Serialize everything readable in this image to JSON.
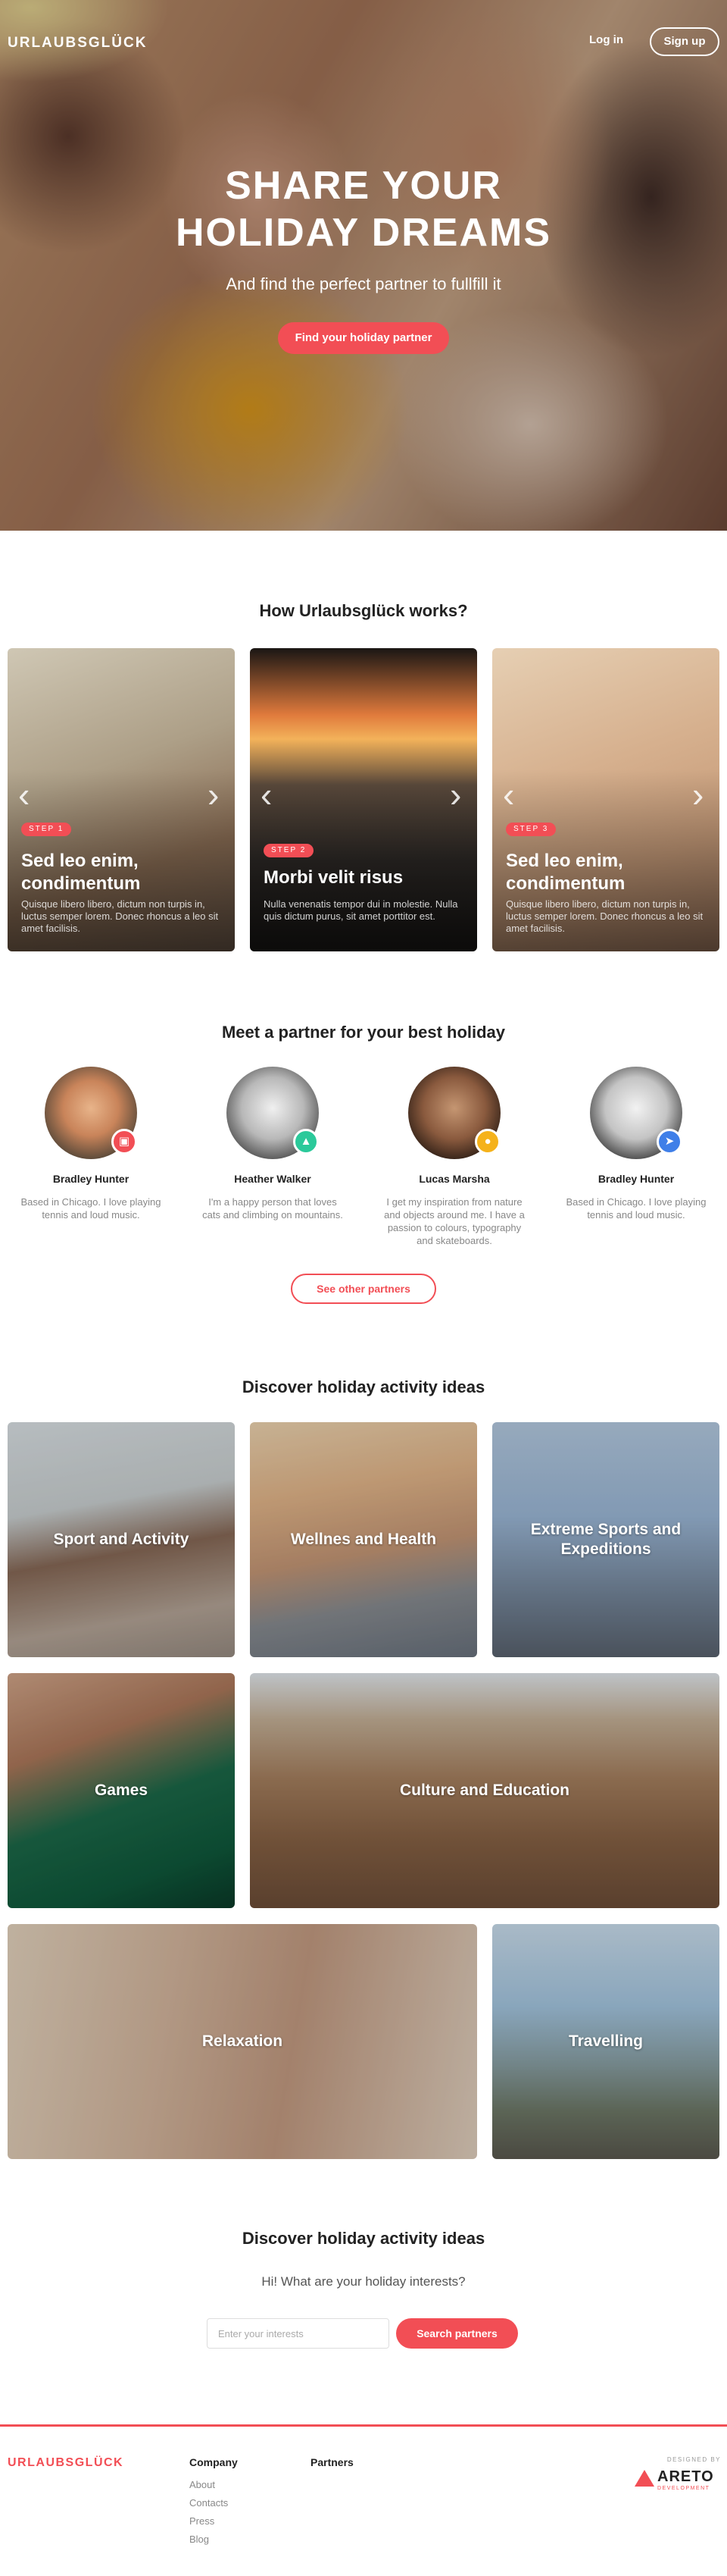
{
  "header": {
    "logo": "URLAUBSGLÜCK",
    "login_label": "Log in",
    "signup_label": "Sign up"
  },
  "hero": {
    "title_line1": "SHARE YOUR",
    "title_line2": "HOLIDAY DREAMS",
    "subtitle": "And find the perfect partner to fullfill it",
    "cta_label": "Find your holiday partner"
  },
  "how": {
    "title": "How Urlaubsglück works?",
    "cards": [
      {
        "step": "STEP 1",
        "title": "Sed leo enim, condimentum",
        "text": "Quisque libero libero, dictum non turpis in, luctus semper lorem. Donec rhoncus a leo sit amet facilisis."
      },
      {
        "step": "STEP 2",
        "title": "Morbi velit risus",
        "text": "Nulla venenatis tempor dui in molestie. Nulla quis dictum purus, sit amet porttitor est."
      },
      {
        "step": "STEP 3",
        "title": "Sed leo enim, condimentum",
        "text": "Quisque libero libero, dictum non turpis in, luctus semper lorem. Donec rhoncus a leo sit amet facilisis."
      }
    ],
    "prev_icon": "chevron-left-icon",
    "next_icon": "chevron-right-icon"
  },
  "partners": {
    "title": "Meet a partner for your best holiday",
    "items": [
      {
        "name": "Bradley Hunter",
        "bio": "Based in Chicago. I love playing tennis and loud music.",
        "badge_icon": "camera-icon",
        "badge_color": "#f24e55"
      },
      {
        "name": "Heather Walker",
        "bio": "I'm a happy person that loves cats and climbing on mountains.",
        "badge_icon": "mountain-icon",
        "badge_color": "#2bc99a"
      },
      {
        "name": "Lucas Marsha",
        "bio": "I get my inspiration from nature and objects around me. I have a passion to colours, typography and skateboards.",
        "badge_icon": "palette-icon",
        "badge_color": "#f5b21b"
      },
      {
        "name": "Bradley Hunter",
        "bio": "Based in Chicago. I love playing tennis and loud music.",
        "badge_icon": "paper-plane-icon",
        "badge_color": "#3f7fe8"
      }
    ],
    "more_label": "See other partners"
  },
  "activities": {
    "title": "Discover holiday activity ideas",
    "tiles": [
      "Sport and Activity",
      "Wellnes and Health",
      "Extreme Sports and Expeditions",
      "Games",
      "Culture and Education",
      "Relaxation",
      "Travelling"
    ]
  },
  "search": {
    "title": "Discover holiday activity ideas",
    "subtitle": "Hi! What are your holiday interests?",
    "placeholder": "Enter your interests",
    "button_label": "Search partners"
  },
  "footer": {
    "logo": "URLAUBSGLÜCK",
    "company_title": "Company",
    "company_links": [
      "About",
      "Contacts",
      "Press",
      "Blog"
    ],
    "partners_title": "Partners",
    "designed_by": "DESIGNED BY",
    "designer_name": "ARETO",
    "designer_sub": "DEVELOPMENT"
  },
  "colors": {
    "accent": "#f24e55"
  }
}
